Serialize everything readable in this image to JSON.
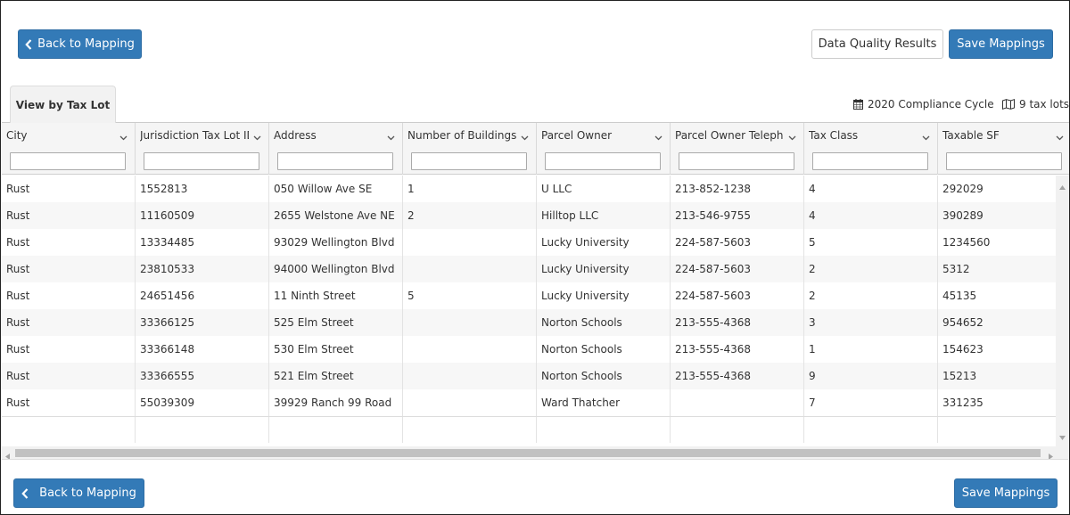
{
  "toolbar": {
    "back_label": "Back to Mapping",
    "data_quality_label": "Data Quality Results",
    "save_label": "Save Mappings"
  },
  "tab": {
    "label": "View by Tax Lot"
  },
  "meta": {
    "cycle": "2020 Compliance Cycle",
    "count": "9 tax lots"
  },
  "table": {
    "columns": [
      "City",
      "Jurisdiction Tax Lot ID",
      "Address",
      "Number of Buildings",
      "Parcel Owner",
      "Parcel Owner Telephone",
      "Tax Class",
      "Taxable SF"
    ],
    "rows": [
      [
        "Rust",
        "1552813",
        "050 Willow Ave SE",
        "1",
        "U LLC",
        "213-852-1238",
        "4",
        "292029"
      ],
      [
        "Rust",
        "11160509",
        "2655 Welstone Ave NE",
        "2",
        "Hilltop LLC",
        "213-546-9755",
        "4",
        "390289"
      ],
      [
        "Rust",
        "13334485",
        "93029 Wellington Blvd",
        "",
        "Lucky University",
        "224-587-5603",
        "5",
        "1234560"
      ],
      [
        "Rust",
        "23810533",
        "94000 Wellington Blvd",
        "",
        "Lucky University",
        "224-587-5603",
        "2",
        "5312"
      ],
      [
        "Rust",
        "24651456",
        "11 Ninth Street",
        "5",
        "Lucky University",
        "224-587-5603",
        "2",
        "45135"
      ],
      [
        "Rust",
        "33366125",
        "525 Elm Street",
        "",
        "Norton Schools",
        "213-555-4368",
        "3",
        "954652"
      ],
      [
        "Rust",
        "33366148",
        "530 Elm Street",
        "",
        "Norton Schools",
        "213-555-4368",
        "1",
        "154623"
      ],
      [
        "Rust",
        "33366555",
        "521 Elm Street",
        "",
        "Norton Schools",
        "213-555-4368",
        "9",
        "15213"
      ],
      [
        "Rust",
        "55039309",
        "39929 Ranch 99 Road",
        "",
        "Ward Thatcher",
        "",
        "7",
        "331235"
      ]
    ]
  },
  "footer": {
    "back_label": "Back to Mapping",
    "save_label": "Save Mappings"
  },
  "colors": {
    "primary": "#337ab7",
    "header_bg": "#f5f5f5",
    "alt_row": "#f7f7f7"
  }
}
